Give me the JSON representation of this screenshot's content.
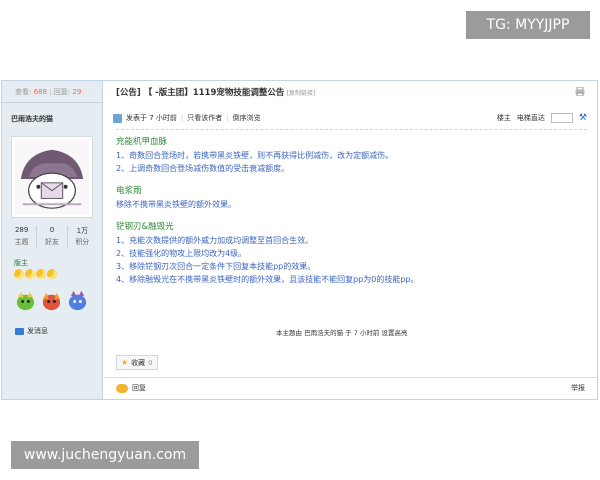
{
  "watermarks": {
    "top": "TG: MYYJJPP",
    "bottom": "www.juchengyuan.com"
  },
  "sidebar": {
    "views_label": "查看:",
    "views_count": "688",
    "replies_label": "回复:",
    "replies_count": "29",
    "author": "巴雨浩夫的猫",
    "stats": [
      {
        "value": "289",
        "label": "主题"
      },
      {
        "value": "0",
        "label": "好友"
      },
      {
        "value": "1万",
        "label": "积分"
      }
    ],
    "rank": "版主",
    "send_message": "发消息"
  },
  "thread": {
    "title": "[公告] 【 -版主团】1119宠物技能调整公告",
    "copy_link": "[复制链接]",
    "posted": "发表于 7 小时前",
    "only_author": "只看该作者",
    "reverse": "倒序浏览",
    "floor": "楼主",
    "jump_label": "电梯直达"
  },
  "content": {
    "sections": [
      {
        "title": "充能机甲血脉",
        "lines": [
          "1、奇数回合登场时，若携带黑炎铁壁，则不再获得比例减伤，改为定额减伤。",
          "2、上调奇数回合登场减伤数值的受击衰减额度。"
        ]
      },
      {
        "title": "电浆雨",
        "lines": [
          "移除不携带黑炎铁壁的额外效果。"
        ]
      },
      {
        "title": "铓钢刃&融毁光",
        "lines": [
          "1、充能次数提供的额外威力加成均调整至首回合生效。",
          "2、技能强化的物攻上限均改为4级。",
          "3、移除铓钢刃次回合一定条件下回复本技能pp的效果。",
          "4、移除融毁光在不携带黑炎铁壁时的额外效果，且该技能不能回复pp为0的技能pp。"
        ]
      }
    ],
    "footer_note": "本主题由 巴雨浩夫的猫 于 7 小时前 设置高亮"
  },
  "actions": {
    "favorite_label": "收藏",
    "favorite_count": "0",
    "reply": "回复",
    "report": "举报"
  },
  "colors": {
    "section_title": "#2d8b3a",
    "body_text": "#3c64c0",
    "highlight_count": "#f26c4f"
  }
}
